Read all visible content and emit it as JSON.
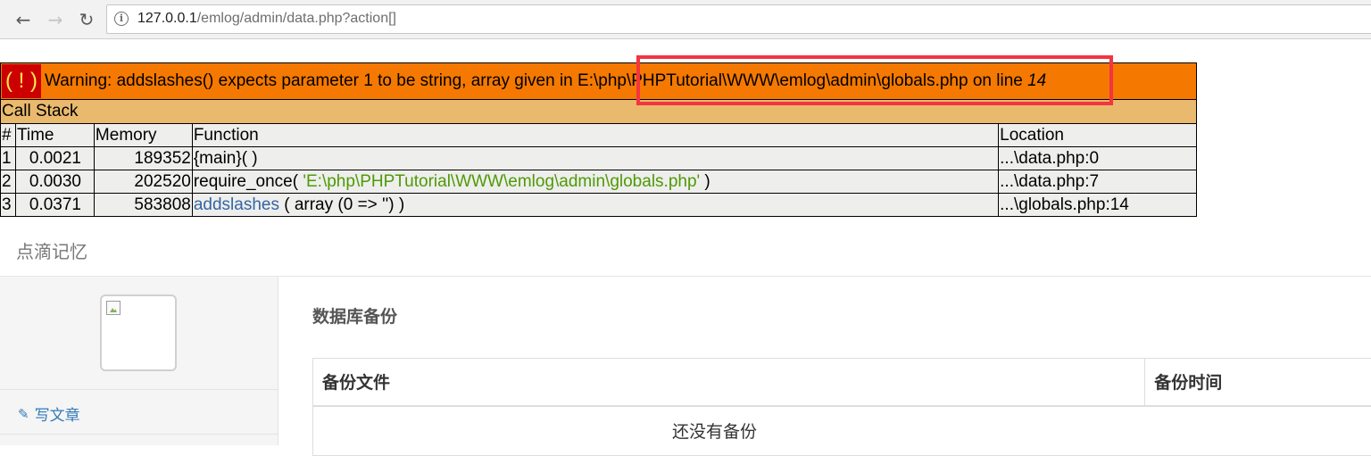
{
  "browser": {
    "back": "←",
    "forward": "→",
    "reload": "↻",
    "info": "i",
    "url_host": "127.0.0.1",
    "url_path": "/emlog/admin/data.php?action[]"
  },
  "error": {
    "icon": "( ! )",
    "message_prefix": "Warning: addslashes() expects parameter 1 to be string, array given in ",
    "file": "E:\\php\\PHPTutorial\\WWW\\emlog\\admin\\globals.php",
    "on_line_text": " on line ",
    "line": "14",
    "call_stack_label": "Call Stack",
    "headers": {
      "num": "#",
      "time": "Time",
      "memory": "Memory",
      "function": "Function",
      "location": "Location"
    },
    "rows": [
      {
        "num": "1",
        "time": "0.0021",
        "memory": "189352",
        "fn": "{main}( )",
        "fn_arg": "",
        "fn_tail": "",
        "location": "...\\data.php:0"
      },
      {
        "num": "2",
        "time": "0.0030",
        "memory": "202520",
        "fn": "require_once( ",
        "fn_arg": "'E:\\php\\PHPTutorial\\WWW\\emlog\\admin\\globals.php'",
        "fn_tail": " )",
        "location": "...\\data.php:7"
      },
      {
        "num": "3",
        "time": "0.0371",
        "memory": "583808",
        "fn": "addslashes",
        "fn_arg": "",
        "fn_tail": " ( array (0 => '') )",
        "location": "...\\globals.php:14"
      }
    ]
  },
  "site": {
    "title": "点滴记忆"
  },
  "sidebar": {
    "write_label": "写文章",
    "write_icon": "edit-icon"
  },
  "main": {
    "title": "数据库备份",
    "columns": [
      "备份文件",
      "备份时间"
    ],
    "empty_text": "还没有备份"
  }
}
